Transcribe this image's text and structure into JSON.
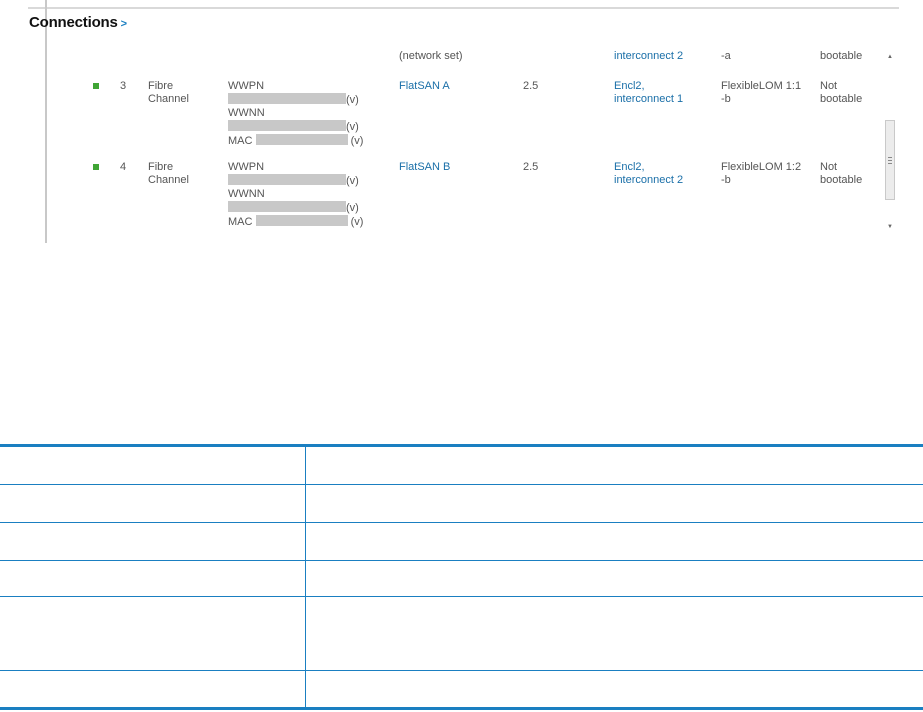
{
  "section": {
    "title": "Connections",
    "chevron": ">"
  },
  "partial_row": {
    "network": "(network set)",
    "port": "interconnect 2",
    "port_suffix": "-a",
    "boot": "bootable"
  },
  "rows": [
    {
      "id": "3",
      "type_line1": "Fibre",
      "type_line2": "Channel",
      "wwpn_label": "WWPN",
      "wwnn_label": "WWNN",
      "mac_label": "MAC",
      "virtual_mark": "(v)",
      "network": "FlatSAN A",
      "bandwidth": "2.5",
      "port_line1": "Encl2,",
      "port_line2": "interconnect 1",
      "adapter_line1": "FlexibleLOM 1:1",
      "adapter_line2": "-b",
      "boot_line1": "Not",
      "boot_line2": "bootable",
      "status_color": "#3fa535"
    },
    {
      "id": "4",
      "type_line1": "Fibre",
      "type_line2": "Channel",
      "wwpn_label": "WWPN",
      "wwnn_label": "WWNN",
      "mac_label": "MAC",
      "virtual_mark": "(v)",
      "network": "FlatSAN B",
      "bandwidth": "2.5",
      "port_line1": "Encl2,",
      "port_line2": "interconnect 2",
      "adapter_line1": "FlexibleLOM 1:2",
      "adapter_line2": "-b",
      "boot_line1": "Not",
      "boot_line2": "bootable",
      "status_color": "#3fa535"
    }
  ],
  "colors": {
    "accent": "#1a7fc1",
    "link": "#1a6fa8",
    "redaction": "#c8c8c8"
  }
}
